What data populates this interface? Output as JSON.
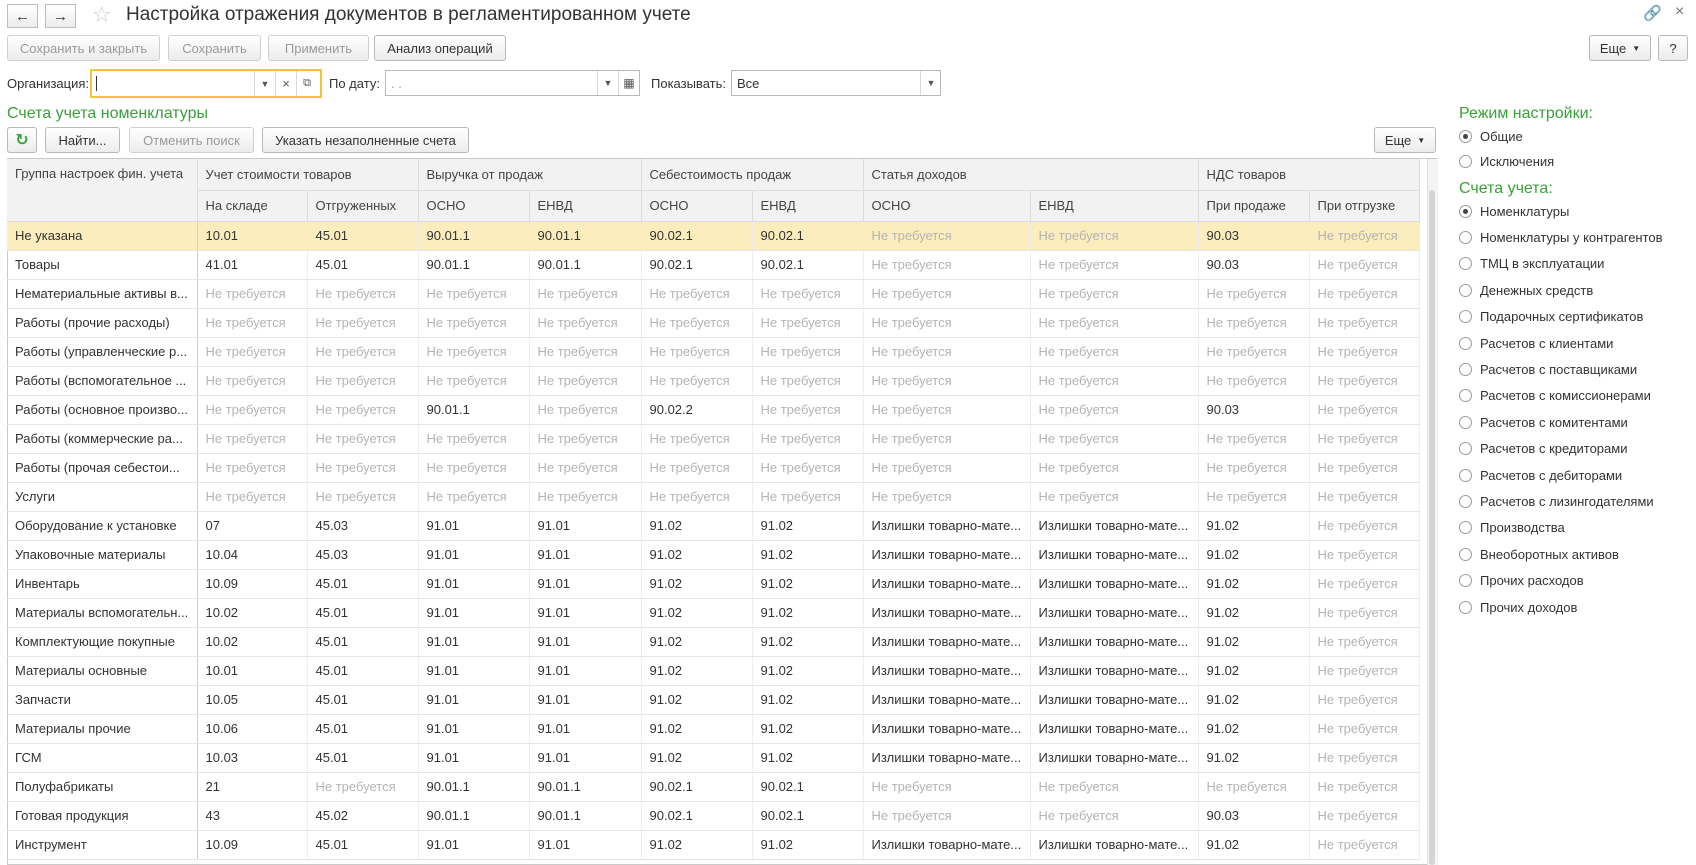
{
  "window": {
    "title": "Настройка отражения документов в регламентированном учете"
  },
  "toolbar": {
    "save_close": "Сохранить и закрыть",
    "save": "Сохранить",
    "apply": "Применить",
    "analysis": "Анализ операций",
    "more": "Еще",
    "help": "?"
  },
  "filters": {
    "org_label": "Организация:",
    "org_value": "",
    "date_label": "По дату:",
    "date_value": ". .",
    "show_label": "Показывать:",
    "show_value": "Все"
  },
  "section": {
    "title": "Счета учета номенклатуры",
    "find": "Найти...",
    "cancel_search": "Отменить поиск",
    "empty_accounts": "Указать незаполненные счета",
    "more": "Еще"
  },
  "table": {
    "group_header": "Группа настроек фин. учета",
    "top_headers": [
      "Учет стоимости товаров",
      "Выручка от продаж",
      "Себестоимость продаж",
      "Статья доходов",
      "НДС товаров"
    ],
    "sub_headers": [
      "На складе",
      "Отгруженных",
      "ОСНО",
      "ЕНВД",
      "ОСНО",
      "ЕНВД",
      "ОСНО",
      "ЕНВД",
      "При продаже",
      "При отгрузке"
    ],
    "rows": [
      {
        "name": "Не указана",
        "cells": [
          "10.01",
          "45.01",
          "90.01.1",
          "90.01.1",
          "90.02.1",
          "90.02.1",
          "Не требуется",
          "Не требуется",
          "90.03",
          "Не требуется"
        ]
      },
      {
        "name": "Товары",
        "cells": [
          "41.01",
          "45.01",
          "90.01.1",
          "90.01.1",
          "90.02.1",
          "90.02.1",
          "Не требуется",
          "Не требуется",
          "90.03",
          "Не требуется"
        ]
      },
      {
        "name": "Нематериальные активы в...",
        "cells": [
          "Не требуется",
          "Не требуется",
          "Не требуется",
          "Не требуется",
          "Не требуется",
          "Не требуется",
          "Не требуется",
          "Не требуется",
          "Не требуется",
          "Не требуется"
        ]
      },
      {
        "name": "Работы (прочие расходы)",
        "cells": [
          "Не требуется",
          "Не требуется",
          "Не требуется",
          "Не требуется",
          "Не требуется",
          "Не требуется",
          "Не требуется",
          "Не требуется",
          "Не требуется",
          "Не требуется"
        ]
      },
      {
        "name": "Работы (управленческие р...",
        "cells": [
          "Не требуется",
          "Не требуется",
          "Не требуется",
          "Не требуется",
          "Не требуется",
          "Не требуется",
          "Не требуется",
          "Не требуется",
          "Не требуется",
          "Не требуется"
        ]
      },
      {
        "name": "Работы (вспомогательное ...",
        "cells": [
          "Не требуется",
          "Не требуется",
          "Не требуется",
          "Не требуется",
          "Не требуется",
          "Не требуется",
          "Не требуется",
          "Не требуется",
          "Не требуется",
          "Не требуется"
        ]
      },
      {
        "name": "Работы (основное произво...",
        "cells": [
          "Не требуется",
          "Не требуется",
          "90.01.1",
          "Не требуется",
          "90.02.2",
          "Не требуется",
          "Не требуется",
          "Не требуется",
          "90.03",
          "Не требуется"
        ]
      },
      {
        "name": "Работы (коммерческие ра...",
        "cells": [
          "Не требуется",
          "Не требуется",
          "Не требуется",
          "Не требуется",
          "Не требуется",
          "Не требуется",
          "Не требуется",
          "Не требуется",
          "Не требуется",
          "Не требуется"
        ]
      },
      {
        "name": "Работы (прочая себестои...",
        "cells": [
          "Не требуется",
          "Не требуется",
          "Не требуется",
          "Не требуется",
          "Не требуется",
          "Не требуется",
          "Не требуется",
          "Не требуется",
          "Не требуется",
          "Не требуется"
        ]
      },
      {
        "name": "Услуги",
        "cells": [
          "Не требуется",
          "Не требуется",
          "Не требуется",
          "Не требуется",
          "Не требуется",
          "Не требуется",
          "Не требуется",
          "Не требуется",
          "Не требуется",
          "Не требуется"
        ]
      },
      {
        "name": "Оборудование к установке",
        "cells": [
          "07",
          "45.03",
          "91.01",
          "91.01",
          "91.02",
          "91.02",
          "Излишки товарно-мате...",
          "Излишки товарно-мате...",
          "91.02",
          "Не требуется"
        ]
      },
      {
        "name": "Упаковочные материалы",
        "cells": [
          "10.04",
          "45.03",
          "91.01",
          "91.01",
          "91.02",
          "91.02",
          "Излишки товарно-мате...",
          "Излишки товарно-мате...",
          "91.02",
          "Не требуется"
        ]
      },
      {
        "name": "Инвентарь",
        "cells": [
          "10.09",
          "45.01",
          "91.01",
          "91.01",
          "91.02",
          "91.02",
          "Излишки товарно-мате...",
          "Излишки товарно-мате...",
          "91.02",
          "Не требуется"
        ]
      },
      {
        "name": "Материалы вспомогательн...",
        "cells": [
          "10.02",
          "45.01",
          "91.01",
          "91.01",
          "91.02",
          "91.02",
          "Излишки товарно-мате...",
          "Излишки товарно-мате...",
          "91.02",
          "Не требуется"
        ]
      },
      {
        "name": "Комплектующие покупные",
        "cells": [
          "10.02",
          "45.01",
          "91.01",
          "91.01",
          "91.02",
          "91.02",
          "Излишки товарно-мате...",
          "Излишки товарно-мате...",
          "91.02",
          "Не требуется"
        ]
      },
      {
        "name": "Материалы основные",
        "cells": [
          "10.01",
          "45.01",
          "91.01",
          "91.01",
          "91.02",
          "91.02",
          "Излишки товарно-мате...",
          "Излишки товарно-мате...",
          "91.02",
          "Не требуется"
        ]
      },
      {
        "name": "Запчасти",
        "cells": [
          "10.05",
          "45.01",
          "91.01",
          "91.01",
          "91.02",
          "91.02",
          "Излишки товарно-мате...",
          "Излишки товарно-мате...",
          "91.02",
          "Не требуется"
        ]
      },
      {
        "name": "Материалы прочие",
        "cells": [
          "10.06",
          "45.01",
          "91.01",
          "91.01",
          "91.02",
          "91.02",
          "Излишки товарно-мате...",
          "Излишки товарно-мате...",
          "91.02",
          "Не требуется"
        ]
      },
      {
        "name": "ГСМ",
        "cells": [
          "10.03",
          "45.01",
          "91.01",
          "91.01",
          "91.02",
          "91.02",
          "Излишки товарно-мате...",
          "Излишки товарно-мате...",
          "91.02",
          "Не требуется"
        ]
      },
      {
        "name": "Полуфабрикаты",
        "cells": [
          "21",
          "Не требуется",
          "90.01.1",
          "90.01.1",
          "90.02.1",
          "90.02.1",
          "Не требуется",
          "Не требуется",
          "Не требуется",
          "Не требуется"
        ]
      },
      {
        "name": "Готовая продукция",
        "cells": [
          "43",
          "45.02",
          "90.01.1",
          "90.01.1",
          "90.02.1",
          "90.02.1",
          "Не требуется",
          "Не требуется",
          "90.03",
          "Не требуется"
        ]
      },
      {
        "name": "Инструмент",
        "cells": [
          "10.09",
          "45.01",
          "91.01",
          "91.01",
          "91.02",
          "91.02",
          "Излишки товарно-мате...",
          "Излишки товарно-мате...",
          "91.02",
          "Не требуется"
        ]
      }
    ]
  },
  "side": {
    "mode_title": "Режим настройки:",
    "mode_options": [
      {
        "label": "Общие",
        "checked": true
      },
      {
        "label": "Исключения",
        "checked": false
      }
    ],
    "accounts_title": "Счета учета:",
    "accounts_options": [
      {
        "label": "Номенклатуры",
        "checked": true
      },
      {
        "label": "Номенклатуры у контрагентов",
        "checked": false
      },
      {
        "label": "ТМЦ в эксплуатации",
        "checked": false
      },
      {
        "label": "Денежных средств",
        "checked": false
      },
      {
        "label": "Подарочных сертификатов",
        "checked": false
      },
      {
        "label": "Расчетов с клиентами",
        "checked": false
      },
      {
        "label": "Расчетов с поставщиками",
        "checked": false
      },
      {
        "label": "Расчетов с комиссионерами",
        "checked": false
      },
      {
        "label": "Расчетов с комитентами",
        "checked": false
      },
      {
        "label": "Расчетов с кредиторами",
        "checked": false
      },
      {
        "label": "Расчетов с дебиторами",
        "checked": false
      },
      {
        "label": "Расчетов с лизингодателями",
        "checked": false
      },
      {
        "label": "Производства",
        "checked": false
      },
      {
        "label": "Внеоборотных активов",
        "checked": false
      },
      {
        "label": "Прочих расходов",
        "checked": false
      },
      {
        "label": "Прочих доходов",
        "checked": false
      }
    ]
  },
  "colors": {
    "accent_green": "#3aa03a",
    "selected_row": "#fbedbd",
    "muted_text": "#b4b4b4",
    "field_focus": "#f5c33b"
  }
}
